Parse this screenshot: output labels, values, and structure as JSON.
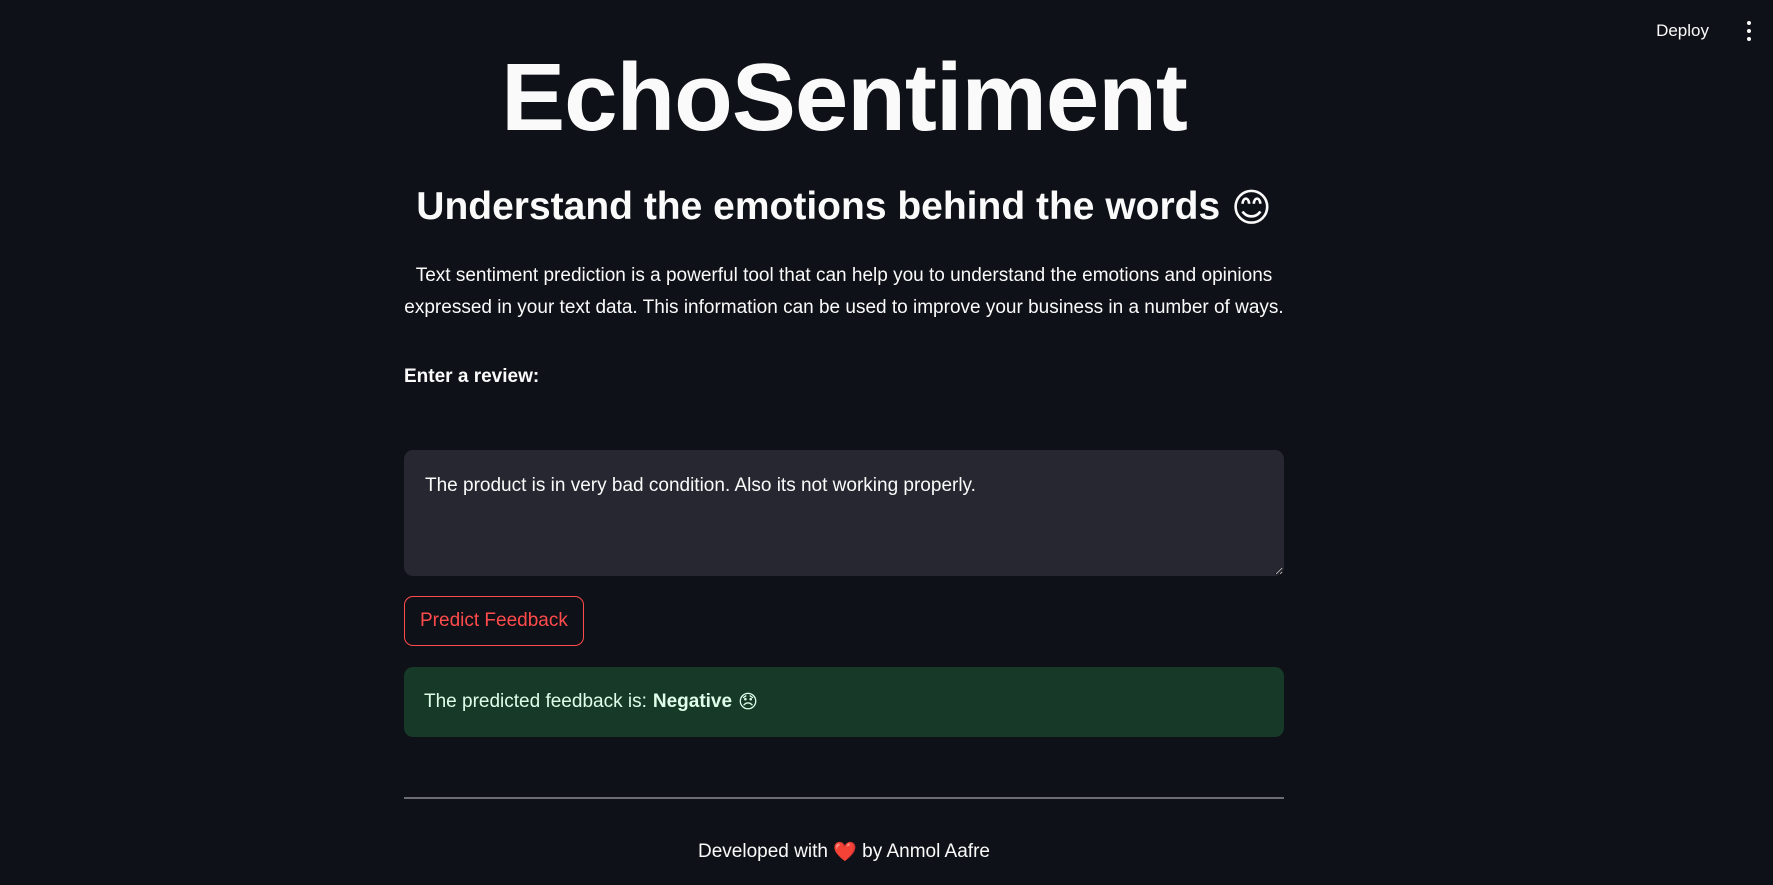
{
  "toolbar": {
    "deploy_label": "Deploy",
    "menu_icon": "more-vertical-icon"
  },
  "header": {
    "title": "EchoSentiment",
    "subtitle": "Understand the emotions behind the words",
    "subtitle_emoji": "😊",
    "description": "Text sentiment prediction is a powerful tool that can help you to understand the emotions and opinions expressed in your text data. This information can be used to improve your business in a number of ways."
  },
  "form": {
    "review_label": "Enter a review:",
    "review_value": "The product is in very bad condition. Also its not working properly.",
    "predict_label": "Predict Feedback"
  },
  "result": {
    "prefix": "The predicted feedback is:",
    "value": "Negative",
    "emoji": "😞"
  },
  "footer": {
    "prefix": "Developed with",
    "heart": "❤️",
    "suffix": "by Anmol Aafre"
  },
  "colors": {
    "background": "#0e1117",
    "accent": "#ff4b4b",
    "success_bg": "#173928",
    "input_bg": "#262730"
  }
}
